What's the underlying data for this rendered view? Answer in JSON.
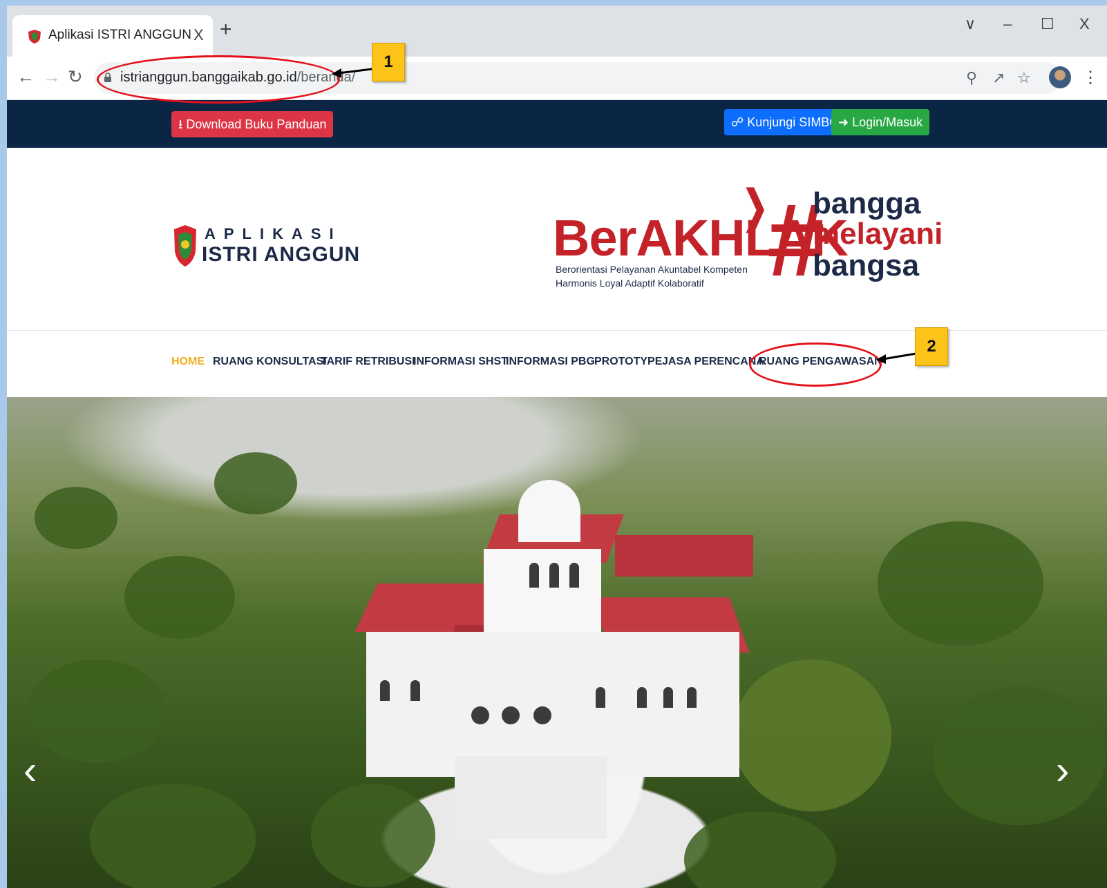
{
  "browser": {
    "tab_title": "Aplikasi ISTRI ANGGUN",
    "tab_close": "X",
    "new_tab": "+",
    "controls": {
      "tab_search": "∨",
      "minimize": "–",
      "maximize": "☐",
      "close": "X"
    },
    "url_host": "istrianggun.banggaikab.go.id",
    "url_path": "/beranda/"
  },
  "topbar": {
    "download_label": "Download Buku Panduan",
    "simbg_label": "Kunjungi SIMBG",
    "login_label": "Login/Masuk"
  },
  "header": {
    "logo_line1": "APLIKASI",
    "logo_line2": "ISTRI ANGGUN",
    "berakhlak": "BerAKHLAK",
    "berakhlak_sub1": "Berorientasi Pelayanan Akuntabel Kompeten",
    "berakhlak_sub2": "Harmonis Loyal Adaptif Kolaboratif",
    "hashtag": "#",
    "tag_line1": "bangga",
    "tag_line2": "melayani",
    "tag_line3": "bangsa"
  },
  "nav": {
    "items": [
      {
        "label": "HOME"
      },
      {
        "label": "RUANG KONSULTASI"
      },
      {
        "label": "TARIF RETRIBUSI"
      },
      {
        "label": "INFORMASI SHST"
      },
      {
        "label": "INFORMASI PBG"
      },
      {
        "label": "PROTOTYPE"
      },
      {
        "label": "JASA PERENCANA"
      },
      {
        "label": "RUANG PENGAWASAN"
      }
    ]
  },
  "carousel": {
    "prev": "‹",
    "next": "›"
  },
  "annotations": {
    "callout1": "1",
    "callout2": "2"
  },
  "colors": {
    "topbar_bg": "#0b2545",
    "active_nav": "#f0ad1f",
    "brand_red": "#c32228",
    "annotation_red": "#e3121b",
    "callout_yellow": "#fcc419"
  },
  "icons": {
    "download": "download-icon",
    "link": "link-icon",
    "login": "login-icon",
    "lock": "lock-icon",
    "zoom": "zoom-icon",
    "share": "share-icon",
    "star": "star-icon"
  }
}
